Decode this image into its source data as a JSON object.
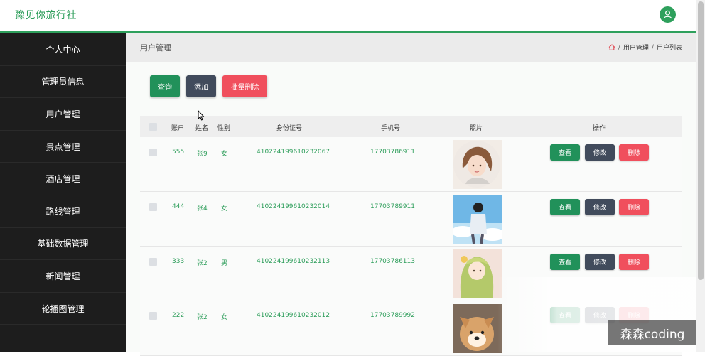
{
  "app": {
    "brand": "豫见你旅行社"
  },
  "sidebar": {
    "items": [
      {
        "label": "个人中心"
      },
      {
        "label": "管理员信息"
      },
      {
        "label": "用户管理"
      },
      {
        "label": "景点管理"
      },
      {
        "label": "酒店管理"
      },
      {
        "label": "路线管理"
      },
      {
        "label": "基础数据管理"
      },
      {
        "label": "新闻管理"
      },
      {
        "label": "轮播图管理"
      }
    ]
  },
  "breadcrumb": {
    "title": "用户管理",
    "path": [
      "用户管理",
      "用户列表"
    ]
  },
  "toolbar": {
    "query": "查询",
    "add": "添加",
    "batch_delete": "批量删除"
  },
  "table": {
    "headers": {
      "account": "账户",
      "name": "姓名",
      "gender": "性别",
      "id_card": "身份证号",
      "phone": "手机号",
      "photo": "照片",
      "actions": "操作"
    },
    "actions": {
      "view": "查看",
      "edit": "修改",
      "delete": "删除"
    },
    "rows": [
      {
        "account": "555",
        "name": "张9",
        "gender": "女",
        "id_card": "410224199610232067",
        "phone": "17703786911"
      },
      {
        "account": "444",
        "name": "张4",
        "gender": "女",
        "id_card": "410224199610232014",
        "phone": "17703789911"
      },
      {
        "account": "333",
        "name": "张2",
        "gender": "男",
        "id_card": "410224199610232113",
        "phone": "17703786113"
      },
      {
        "account": "222",
        "name": "张2",
        "gender": "女",
        "id_card": "410224199610232012",
        "phone": "17703789992"
      }
    ]
  },
  "watermark": "森森coding",
  "colors": {
    "accent": "#2ea05c",
    "sidebar_bg": "#1d1d1d",
    "danger": "#f04f5d",
    "dark_button": "#414b5c"
  }
}
